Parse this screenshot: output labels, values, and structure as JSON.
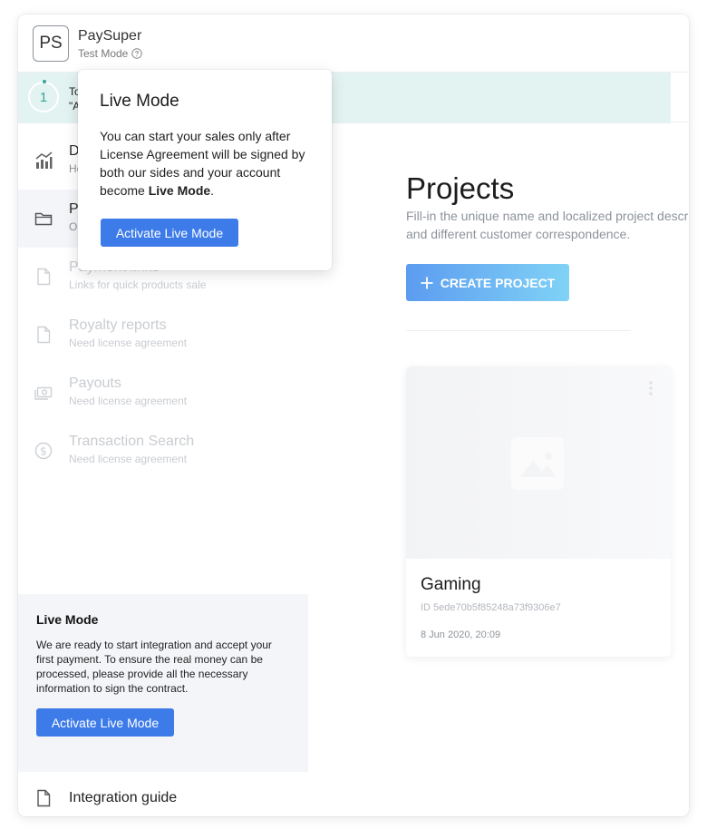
{
  "header": {
    "logo_text": "PS",
    "app_title": "PaySuper",
    "mode_label": "Test Mode"
  },
  "step_banner": {
    "number": "1",
    "line1": "To",
    "line2": "\"A"
  },
  "sidebar": {
    "items": [
      {
        "title": "D",
        "subtitle": "Ho",
        "icon": "chart-icon",
        "state": "normal"
      },
      {
        "title": "P",
        "subtitle": "Or",
        "icon": "folder-icon",
        "state": "active"
      },
      {
        "title": "Payment links",
        "subtitle": "Links for quick products sale",
        "icon": "document-icon",
        "state": "disabled"
      },
      {
        "title": "Royalty reports",
        "subtitle": "Need license agreement",
        "icon": "document-icon",
        "state": "disabled"
      },
      {
        "title": "Payouts",
        "subtitle": "Need license agreement",
        "icon": "payout-icon",
        "state": "disabled"
      },
      {
        "title": "Transaction Search",
        "subtitle": "Need license agreement",
        "icon": "dollar-icon",
        "state": "disabled"
      }
    ],
    "live_card": {
      "title": "Live Mode",
      "text": "We are ready to start integration and accept your first payment. To ensure the real money can be processed, please provide all the necessary information to sign the contract.",
      "button": "Activate Live Mode"
    },
    "guide_label": "Integration guide"
  },
  "main": {
    "title": "Projects",
    "description": "Fill-in the unique name and localized project description to display on payment form and different customer correspondence.",
    "create_button": "CREATE PROJECT",
    "project": {
      "name": "Gaming",
      "id_text": "ID 5ede70b5f85248a73f9306e7",
      "date": "8 Jun 2020, 20:09"
    }
  },
  "popover": {
    "title": "Live Mode",
    "text_before": "You can start your sales only after License Agreement will be signed by both our sides and your account become ",
    "text_bold": "Live Mode",
    "text_after": ".",
    "button": "Activate Live Mode"
  },
  "colors": {
    "accent": "#3d7be9",
    "gradient_start": "#5c9cf0",
    "gradient_end": "#80d2f6",
    "banner": "#e3f3f1",
    "step": "#3aa39b"
  }
}
